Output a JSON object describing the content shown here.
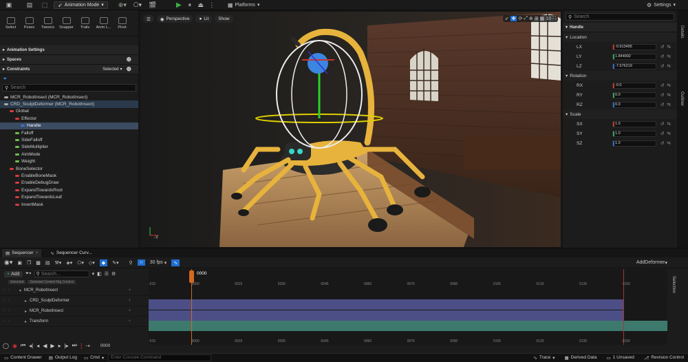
{
  "topbar": {
    "mode_label": "Animation Mode",
    "platforms_label": "Platforms",
    "settings_label": "Settings"
  },
  "anim_tools": [
    {
      "label": "Select"
    },
    {
      "label": "Poses"
    },
    {
      "label": "Tweens"
    },
    {
      "label": "Snapper"
    },
    {
      "label": "Trails"
    },
    {
      "label": "Anim L..."
    },
    {
      "label": "Pivot"
    }
  ],
  "animation_settings_label": "Animation Settings",
  "spaces_label": "Spaces",
  "constraints_label": "Constraints",
  "constraints_value": "Selected",
  "rig_search_placeholder": "Search",
  "rig_tree": [
    {
      "label": "MCR_RobotInsect (MCR_RobotInsect)",
      "indent": 0,
      "color": "#aaa",
      "state": ""
    },
    {
      "label": "CRD_SculptDeformer (MCR_RobotInsect)",
      "indent": 0,
      "color": "#aaa",
      "state": "hl"
    },
    {
      "label": "Global",
      "indent": 1,
      "color": "#d63c3c",
      "state": ""
    },
    {
      "label": "Effector",
      "indent": 2,
      "color": "#d63c3c",
      "state": ""
    },
    {
      "label": "Handle",
      "indent": 3,
      "color": "#3a76c4",
      "state": "sel"
    },
    {
      "label": "Falloff",
      "indent": 2,
      "color": "#6ac24e",
      "state": ""
    },
    {
      "label": "SideFalloff",
      "indent": 2,
      "color": "#6ac24e",
      "state": ""
    },
    {
      "label": "SideMultiplier",
      "indent": 2,
      "color": "#6ac24e",
      "state": ""
    },
    {
      "label": "AimMode",
      "indent": 2,
      "color": "#6ac24e",
      "state": ""
    },
    {
      "label": "Weight",
      "indent": 2,
      "color": "#6ac24e",
      "state": ""
    },
    {
      "label": "BoneSelector",
      "indent": 1,
      "color": "#d63c3c",
      "state": ""
    },
    {
      "label": "EnableBoneMask",
      "indent": 2,
      "color": "#d63c3c",
      "state": ""
    },
    {
      "label": "EnableDebugDraw",
      "indent": 2,
      "color": "#d63c3c",
      "state": ""
    },
    {
      "label": "ExpandTowardsRoot",
      "indent": 2,
      "color": "#d63c3c",
      "state": ""
    },
    {
      "label": "ExpandTowardsLeaf",
      "indent": 2,
      "color": "#d63c3c",
      "state": ""
    },
    {
      "label": "InvertMask",
      "indent": 2,
      "color": "#d63c3c",
      "state": ""
    }
  ],
  "viewport": {
    "perspective_label": "Perspective",
    "lit_label": "Lit",
    "show_label": "Show",
    "grid_value": "10"
  },
  "details": {
    "search_placeholder": "Search",
    "handle_label": "Handle",
    "location_label": "Location",
    "rotation_label": "Rotation",
    "scale_label": "Scale",
    "location": [
      {
        "label": "LX",
        "value": "-0.913495",
        "color": "#c0392b"
      },
      {
        "label": "LY",
        "value": "1.844992",
        "color": "#27ae60"
      },
      {
        "label": "LZ",
        "value": "-7.576219",
        "color": "#2e6ed1"
      }
    ],
    "rotation": [
      {
        "label": "RX",
        "value": "-0.0",
        "color": "#c0392b"
      },
      {
        "label": "RY",
        "value": "0.0",
        "color": "#27ae60"
      },
      {
        "label": "RZ",
        "value": "0.0",
        "color": "#2e6ed1"
      }
    ],
    "scale": [
      {
        "label": "SX",
        "value": "1.0",
        "color": "#c0392b"
      },
      {
        "label": "SY",
        "value": "1.0",
        "color": "#27ae60"
      },
      {
        "label": "SZ",
        "value": "1.0",
        "color": "#2e6ed1"
      }
    ],
    "side_tabs": [
      "Details",
      "Outliner"
    ]
  },
  "sequencer": {
    "tab1": "Sequencer",
    "tab2": "Sequencer Curv...",
    "fps_label": "30 fps",
    "add_deformer_label": "AddDeformer",
    "add_label": "Add",
    "search_placeholder": "Search...",
    "filter_selected": "Selected",
    "filter_control": "Selected Control Rig Control",
    "current_frame": "0000",
    "frame_field": "0000",
    "selection_tab": "Selection",
    "ticks": [
      "-015",
      "0000",
      "0015",
      "0030",
      "0045",
      "0060",
      "0075",
      "0090",
      "0105",
      "0120",
      "0135",
      "0150"
    ],
    "tracks": [
      {
        "label": "MCR_RobotInsect",
        "indent": 0
      },
      {
        "label": "CRD_SculptDeformer",
        "indent": 1
      },
      {
        "label": "MCR_RobotInsect",
        "indent": 1
      },
      {
        "label": "Transform",
        "indent": 1
      }
    ]
  },
  "statusbar": {
    "content_drawer": "Content Drawer",
    "output_log": "Output Log",
    "cmd": "Cmd",
    "console_placeholder": "Enter Console Command",
    "trace": "Trace",
    "derived_data": "Derived Data",
    "unsaved": "1 Unsaved",
    "revision_control": "Revision Control"
  },
  "colors": {
    "accent_blue": "#1f6fd1",
    "playhead": "#d2691e",
    "track_purple": "#4c4f86",
    "track_teal": "#3d7a6d"
  }
}
